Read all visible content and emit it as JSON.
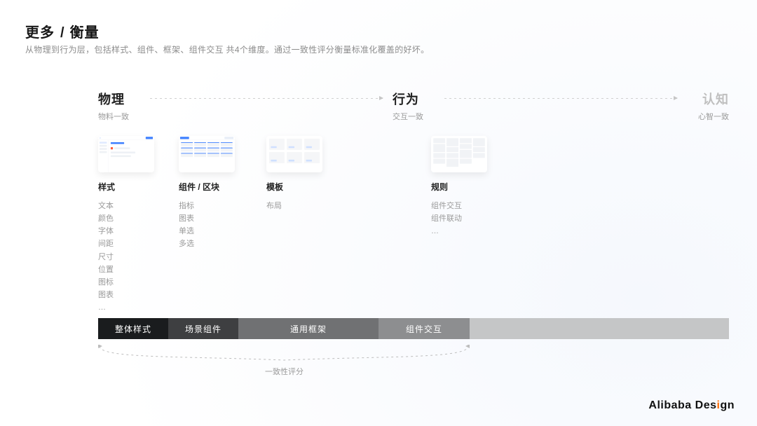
{
  "title": {
    "more": "更多",
    "sep": "/",
    "main": "衡量"
  },
  "subtitle": "从物理到行为层，包括样式、组件、框架、组件交互 共4个维度。通过一致性评分衡量标准化覆盖的好坏。",
  "axis": {
    "physical": {
      "heading": "物理",
      "sub": "物料一致"
    },
    "behavior": {
      "heading": "行为",
      "sub": "交互一致"
    },
    "cognition": {
      "heading": "认知",
      "sub": "心智一致"
    }
  },
  "columns": {
    "style": {
      "title": "样式",
      "items": [
        "文本",
        "颜色",
        "字体",
        "间距",
        "尺寸",
        "位置",
        "图标",
        "图表",
        "…"
      ]
    },
    "component": {
      "title": "组件 / 区块",
      "items": [
        "指标",
        "图表",
        "单选",
        "多选"
      ]
    },
    "template": {
      "title": "模板",
      "items": [
        "布局"
      ]
    },
    "rule": {
      "title": "规则",
      "items": [
        "组件交互",
        "组件联动",
        "…"
      ]
    }
  },
  "bar": {
    "s1": "整体样式",
    "s2": "场景组件",
    "s3": "通用框架",
    "s4": "组件交互"
  },
  "score_label": "一致性评分",
  "brand": {
    "pre": "Alibaba Des",
    "i": "i",
    "post": "gn"
  }
}
